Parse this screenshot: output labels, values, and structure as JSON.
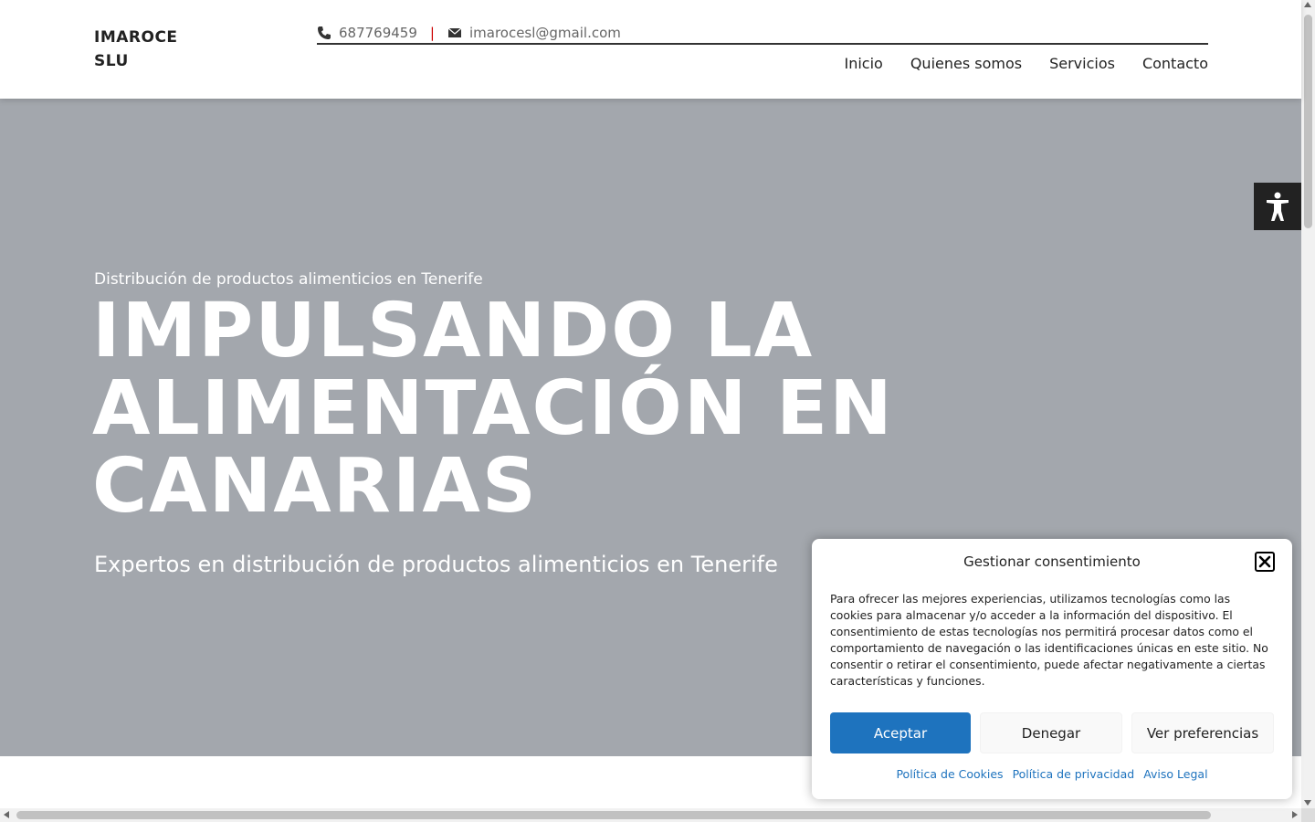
{
  "header": {
    "logo": "IMAROCE SLU",
    "phone": "687769459",
    "separator": "|",
    "email": "imarocesl@gmail.com",
    "nav": [
      "Inicio",
      "Quienes somos",
      "Servicios",
      "Contacto"
    ]
  },
  "hero": {
    "subtitle": "Distribución de productos alimenticios en Tenerife",
    "title": "IMPULSANDO LA ALIMENTACIÓN EN CANARIAS",
    "description": "Expertos en distribución de productos alimenticios en Tenerife"
  },
  "cookie": {
    "title": "Gestionar consentimiento",
    "text": "Para ofrecer las mejores experiencias, utilizamos tecnologías como las cookies para almacenar y/o acceder a la información del dispositivo. El consentimiento de estas tecnologías nos permitirá procesar datos como el comportamiento de navegación o las identificaciones únicas en este sitio. No consentir o retirar el consentimiento, puede afectar negativamente a ciertas características y funciones.",
    "accept": "Aceptar",
    "deny": "Denegar",
    "preferences": "Ver preferencias",
    "links": [
      "Política de Cookies",
      "Política de privacidad",
      "Aviso Legal"
    ]
  },
  "colors": {
    "accent": "#1e73be",
    "hero_bg": "#a3a7ad",
    "separator": "#cc0000"
  },
  "icons": [
    "phone-icon",
    "envelope-icon",
    "accessibility-icon",
    "close-icon"
  ]
}
